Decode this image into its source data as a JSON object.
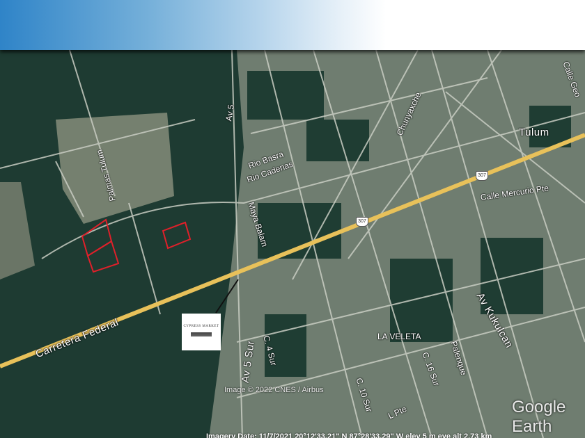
{
  "header": {
    "gradient_start": "#2f84c8",
    "gradient_end": "#ffffff"
  },
  "map": {
    "place_labels": [
      "Tulum",
      "LA VELETA"
    ],
    "street_labels": [
      "Carretera Federal",
      "Av 5 Sur",
      "Av 5",
      "Palmas Tulum",
      "Rio Basra",
      "Rio Cadenas",
      "Maya Balam",
      "Chunyaxche",
      "Calle Mercurio Pte",
      "Av Kukulcan",
      "C. 4 Sur",
      "C. 16 Sur",
      "C. 10 Sur",
      "Palenque",
      "L Pte",
      "Calle Geo"
    ],
    "highway_shields": [
      "307",
      "307"
    ],
    "parcel_color": "#e0202a",
    "highway_color": "#e8c15a",
    "logo_text": "CYPRESS MARKET",
    "credit": "Image © 2022 CNES / Airbus",
    "brand": "Google Earth",
    "status_bar": "Imagery Date: 11/7/2021    20°12'33.21\" N    87°28'33.29\" W   elev    5 m    eye alt  2.73 km"
  }
}
